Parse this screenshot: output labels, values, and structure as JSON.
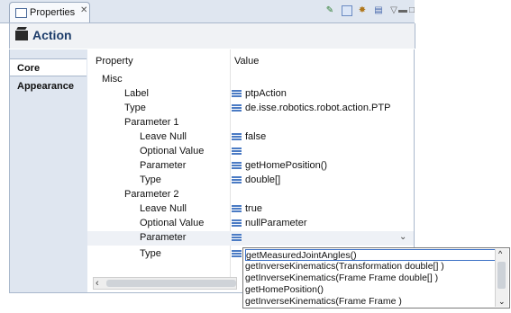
{
  "view_tab": {
    "title": "Properties",
    "close_glyph": "✕"
  },
  "toolbar": {
    "icons": [
      "pin-icon",
      "filter-icon",
      "advanced-icon",
      "group-icon",
      "view-menu-icon",
      "minimize-icon",
      "maximize-icon"
    ]
  },
  "header": {
    "title": "Action"
  },
  "side_tabs": [
    {
      "label": "Core"
    },
    {
      "label": "Appearance"
    }
  ],
  "table": {
    "columns": [
      "Property",
      "Value"
    ],
    "rows": [
      {
        "name": "Misc",
        "value": ""
      },
      {
        "name": "Label",
        "value": "ptpAction"
      },
      {
        "name": "Type",
        "value": "de.isse.robotics.robot.action.PTP"
      },
      {
        "name": "Parameter 1",
        "value": ""
      },
      {
        "name": "Leave Null",
        "value": "false"
      },
      {
        "name": "Optional Value",
        "value": ""
      },
      {
        "name": "Parameter",
        "value": "getHomePosition()"
      },
      {
        "name": "Type",
        "value": "double[]"
      },
      {
        "name": "Parameter 2",
        "value": ""
      },
      {
        "name": "Leave Null",
        "value": "true"
      },
      {
        "name": "Optional Value",
        "value": "nullParameter"
      },
      {
        "name": "Parameter",
        "value": ""
      },
      {
        "name": "Type",
        "value": ""
      }
    ]
  },
  "dropdown": {
    "options": [
      "getMeasuredJointAngles()",
      "getInverseKinematics(Transformation double[] )",
      "getInverseKinematics(Frame Frame double[] )",
      "getHomePosition()",
      "getInverseKinematics(Frame Frame )"
    ],
    "selected": "getMeasuredJointAngles()"
  }
}
